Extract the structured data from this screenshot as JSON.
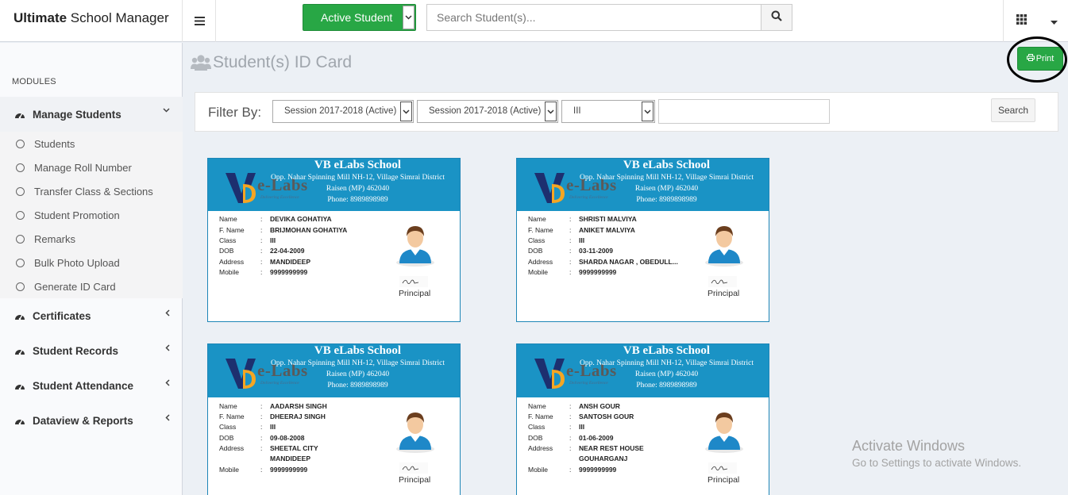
{
  "app": {
    "brand_bold": "Ultimate",
    "brand_rest": " School Manager"
  },
  "header": {
    "student_filter": "Active Student",
    "search_placeholder": "Search Student(s)...",
    "icons": [
      "menu-icon",
      "search-icon",
      "grid-icon",
      "caret-down-icon"
    ]
  },
  "sidebar": {
    "modules_label": "MODULES",
    "manage_students": {
      "label": "Manage Students",
      "items": [
        "Students",
        "Manage Roll Number",
        "Transfer Class & Sections",
        "Student Promotion",
        "Remarks",
        "Bulk Photo Upload",
        "Generate ID Card"
      ]
    },
    "groups": [
      "Certificates",
      "Student Records",
      "Student Attendance",
      "Dataview & Reports"
    ]
  },
  "page": {
    "title": "Student(s) ID Card",
    "print_label": "Print"
  },
  "filter": {
    "label": "Filter By:",
    "session_1": "Session 2017-2018 (Active)",
    "session_2": "Session 2017-2018 (Active)",
    "class": "III",
    "text_value": "",
    "search_label": "Search"
  },
  "card_labels": {
    "name": "Name",
    "father": "F. Name",
    "class": "Class",
    "dob": "DOB",
    "address": "Address",
    "mobile": "Mobile",
    "colon": ":",
    "principal": "Principal"
  },
  "school": {
    "name": "VB eLabs School",
    "address_1": "Opp. Nahar Spinning Mill NH-12, Village Simrai District",
    "address_2": "Raisen (MP) 462040",
    "phone": "Phone: 8989898989",
    "logo_text": "e-Labs",
    "logo_tagline": "Delivering Excellence"
  },
  "students": [
    {
      "name": "DEVIKA GOHATIYA",
      "father": "BRIJMOHAN GOHATIYA",
      "class": "III",
      "dob": "22-04-2009",
      "address": "MANDIDEEP",
      "mobile": "9999999999"
    },
    {
      "name": "SHRISTI MALVIYA",
      "father": "ANIKET MALVIYA",
      "class": "III",
      "dob": "03-11-2009",
      "address": "SHARDA NAGAR , OBEDULL...",
      "mobile": "9999999999"
    },
    {
      "name": "AADARSH SINGH",
      "father": "DHEERAJ SINGH",
      "class": "III",
      "dob": "09-08-2008",
      "address": "SHEETAL CITY MANDIDEEP",
      "mobile": "9999999999"
    },
    {
      "name": "ANSH GOUR",
      "father": "SANTOSH GOUR",
      "class": "III",
      "dob": "01-06-2009",
      "address": "NEAR REST HOUSE GOUHARGANJ",
      "mobile": "9999999999"
    }
  ],
  "watermark": {
    "line1": "Activate Windows",
    "line2": "Go to Settings to activate Windows."
  }
}
